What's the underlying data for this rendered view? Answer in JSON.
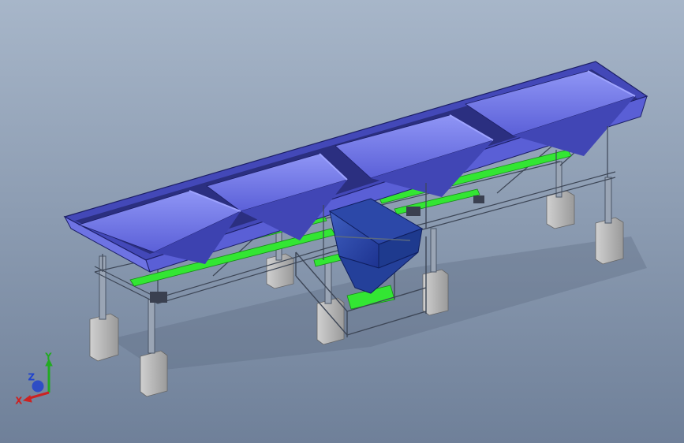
{
  "viewport": {
    "background_top": "#a7b6c9",
    "background_bottom": "#6f8099"
  },
  "model": {
    "hopper_color": "#5a5fd6",
    "belt_color": "#33e633",
    "frame_color": "#8e99a8",
    "footing_color": "#b8b8b8",
    "hopper_count": 4
  },
  "triad": {
    "x_label": "X",
    "y_label": "Y",
    "z_label": "Z",
    "x_color": "#cc2222",
    "y_color": "#22aa22",
    "z_color": "#2244cc"
  }
}
